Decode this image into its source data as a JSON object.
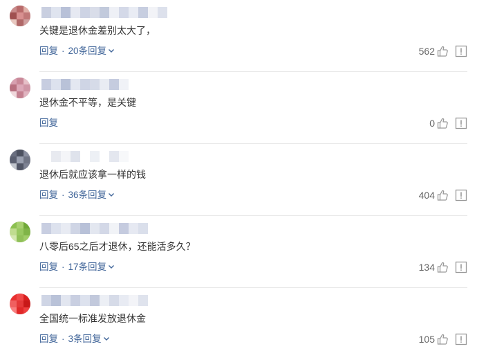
{
  "comments": [
    {
      "text": "关键是退休金差别太大了，",
      "reply_label": "回复",
      "replies_label": "20条回复",
      "like_count": "562",
      "avatar_colors": [
        "#c98b8b",
        "#b86a6a",
        "#e0b0a8",
        "#a05050",
        "#d89090",
        "#c07878",
        "#e8c8c0",
        "#b06868",
        "#d0a0a0"
      ],
      "name_colors": [
        "#c9cfe0",
        "#dfe4ef",
        "#b8c1d8",
        "#e6e9f2",
        "#cdd3e4",
        "#d9dde9",
        "#c2cadc",
        "#eef0f6",
        "#d4d9e8",
        "#e9ecf4",
        "#c7cee0",
        "#f2f3f7",
        "#dde1ec"
      ]
    },
    {
      "text": "退休金不平等，是关键",
      "reply_label": "回复",
      "replies_label": "",
      "like_count": "0",
      "avatar_colors": [
        "#d7a0b0",
        "#c98898",
        "#e6c0c8",
        "#b87080",
        "#dca8b8",
        "#cf96a6",
        "#f0d8dc",
        "#c48090",
        "#e0b4c0"
      ],
      "name_colors": [
        "#c7cde0",
        "#dde2ee",
        "#b9c2d8",
        "#e4e8f1",
        "#cfd5e5",
        "#d6dbe8",
        "#e9ecf3",
        "#c5ccdf",
        "#f0f2f7"
      ]
    },
    {
      "text": "退休后就应该拿一样的钱",
      "reply_label": "回复",
      "replies_label": "36条回复",
      "like_count": "404",
      "avatar_colors": [
        "#6a6f80",
        "#4c5160",
        "#8a8fa0",
        "#5a5f70",
        "#9aa0b0",
        "#707585",
        "#c0c4cc",
        "#505565",
        "#7e8394"
      ],
      "name_colors": [
        "#ffffff",
        "#e8eaf0",
        "#f4f5f8",
        "#dfe3ec",
        "#ffffff",
        "#edf0f5",
        "#ffffff",
        "#e4e7ef",
        "#f7f8fa"
      ]
    },
    {
      "text": "八零后65之后才退休，还能活多久？",
      "reply_label": "回复",
      "replies_label": "17条回复",
      "like_count": "134",
      "avatar_colors": [
        "#8cc050",
        "#a8d070",
        "#70a838",
        "#c0dc90",
        "#98c860",
        "#80b448",
        "#d4e8b0",
        "#90c058",
        "#a0cc68"
      ],
      "name_colors": [
        "#c8cee1",
        "#dde2ee",
        "#e8ebf3",
        "#cfd5e5",
        "#b8c1d8",
        "#e3e7f0",
        "#d3d8e7",
        "#f1f3f7",
        "#c5cbdf",
        "#e6e9f2",
        "#dadfeb"
      ]
    },
    {
      "text": "全国统一标准发放退休金",
      "reply_label": "回复",
      "replies_label": "3条回复",
      "like_count": "105",
      "avatar_colors": [
        "#e83030",
        "#f04848",
        "#d82020",
        "#f06060",
        "#e43838",
        "#c81818",
        "#f88080",
        "#e02828",
        "#ee4040"
      ],
      "name_colors": [
        "#cfd5e5",
        "#b9c2d8",
        "#e2e6f0",
        "#c9cfe1",
        "#dde2ee",
        "#c2c9dc",
        "#eceff5",
        "#d6dbe8",
        "#e8ebf3",
        "#f3f4f8",
        "#dfe3ed"
      ]
    }
  ],
  "icons": {
    "like": "thumbs-up-icon",
    "report": "report-icon",
    "chevron": "chevron-down-icon"
  },
  "colors": {
    "link": "#406599",
    "text": "#333333",
    "count": "#666666",
    "icon": "#999999"
  }
}
